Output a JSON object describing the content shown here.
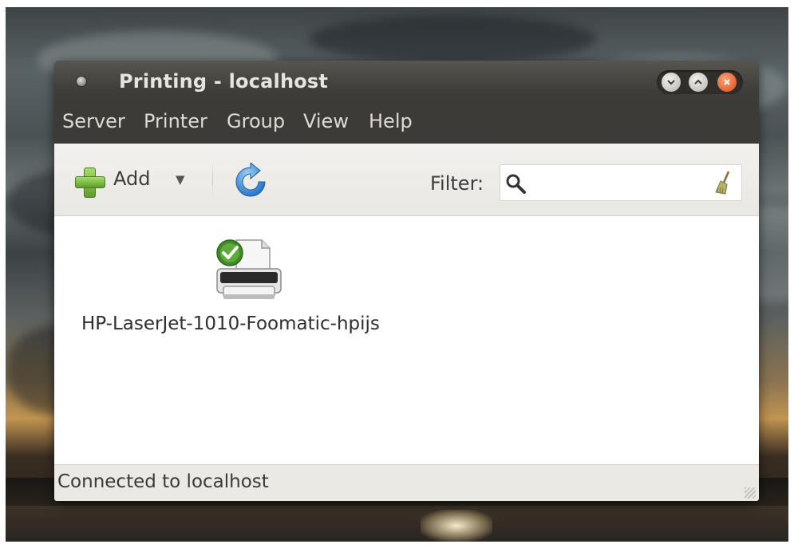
{
  "window": {
    "title": "Printing - localhost"
  },
  "menubar": {
    "items": [
      "Server",
      "Printer",
      "Group",
      "View",
      "Help"
    ]
  },
  "toolbar": {
    "add_label": "Add",
    "filter_label": "Filter:",
    "filter_value": ""
  },
  "printers": [
    {
      "name": "HP-LaserJet-1010-Foomatic-hpijs",
      "status": "default-ready",
      "icon": "printer-icon"
    }
  ],
  "statusbar": {
    "text": "Connected to localhost"
  },
  "colors": {
    "titlebar": "#3c3b37",
    "close_button": "#df4b16",
    "menu_text": "#dfdbd2",
    "toolbar_bg": "#f2f1ef"
  }
}
